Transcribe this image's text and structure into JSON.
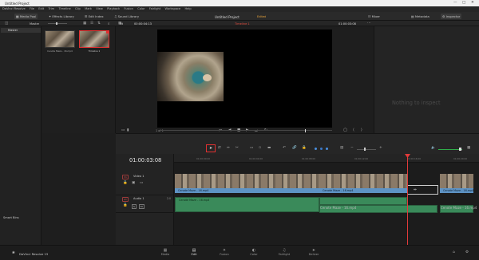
{
  "colors": {
    "accent": "#e64b3c",
    "playhead": "#e23a3a",
    "video_clip": "#5e93c4",
    "audio_clip": "#3a8a5a",
    "selected_tool": "#e03030",
    "edited": "#e6a23c"
  },
  "window": {
    "title": "Untitled Project"
  },
  "menu": [
    "DaVinci Resolve",
    "File",
    "Edit",
    "Trim",
    "Timeline",
    "Clip",
    "Mark",
    "View",
    "Playback",
    "Fusion",
    "Color",
    "Fairlight",
    "Workspace",
    "Help"
  ],
  "toolbar": {
    "media_pool": "Media Pool",
    "effects_library": "Effects Library",
    "edit_index": "Edit Index",
    "sound_library": "Sound Library",
    "project_title": "Untitled Project",
    "project_status": "Edited",
    "mixer": "Mixer",
    "metadata": "Metadata",
    "inspector": "Inspector"
  },
  "subbar": {
    "bin": "Master",
    "fit": "Fit",
    "source_timecode": "00:00:04:13",
    "timeline_name": "Timeline 1",
    "record_timecode": "01:00:03:08"
  },
  "left_panel": {
    "master": "Master",
    "smart_bins": "Smart Bins"
  },
  "media_pool": [
    {
      "name": "Cenote Maze - 16.mp4"
    },
    {
      "name": "Timeline 1"
    }
  ],
  "viewer": {
    "page": "1 of 1"
  },
  "inspector": {
    "empty_text": "Nothing to inspect"
  },
  "timeline": {
    "timecode": "01:00:03:08",
    "ruler": [
      "01:00:00:00",
      "01:00:04:00",
      "01:00:08:00",
      "01:00:12:00",
      "01:00:16:00",
      "01:00:20:00"
    ],
    "video_track": {
      "badge": "V1",
      "name": "Video 1"
    },
    "audio_track": {
      "badge": "A1",
      "name": "Audio 1",
      "channels": "2.0"
    },
    "clip_name": "Cenote Maze - 16.mp4"
  },
  "pages": [
    "Media",
    "Edit",
    "Fusion",
    "Color",
    "Fairlight",
    "Deliver"
  ],
  "footer": {
    "app": "DaVinci Resolve 15"
  }
}
